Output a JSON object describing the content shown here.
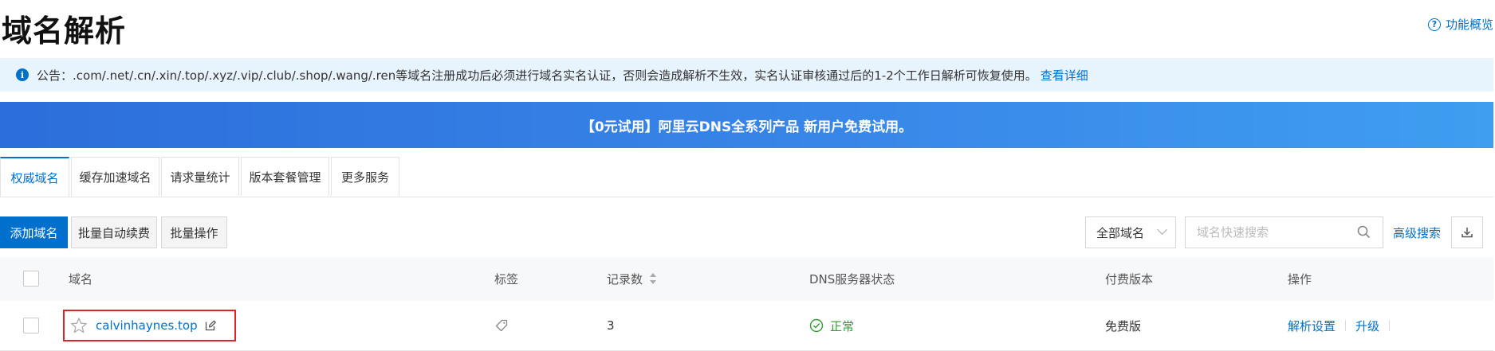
{
  "page": {
    "title": "域名解析",
    "overview_link": "功能概览"
  },
  "notice": {
    "text": "公告：.com/.net/.cn/.xin/.top/.xyz/.vip/.club/.shop/.wang/.ren等域名注册成功后必须进行域名实名认证，否则会造成解析不生效，实名认证审核通过后的1-2个工作日解析可恢复使用。",
    "link": "查看详细"
  },
  "banner": {
    "text": "【0元试用】阿里云DNS全系列产品 新用户免费试用。"
  },
  "tabs": [
    {
      "label": "权威域名",
      "active": true
    },
    {
      "label": "缓存加速域名",
      "active": false
    },
    {
      "label": "请求量统计",
      "active": false
    },
    {
      "label": "版本套餐管理",
      "active": false
    },
    {
      "label": "更多服务",
      "active": false
    }
  ],
  "toolbar": {
    "add_domain": "添加域名",
    "batch_renew": "批量自动续费",
    "batch_ops": "批量操作",
    "filter_selected": "全部域名",
    "search_placeholder": "域名快速搜索",
    "advanced_search": "高级搜索"
  },
  "table": {
    "columns": [
      "域名",
      "标签",
      "记录数",
      "DNS服务器状态",
      "付费版本",
      "操作"
    ],
    "rows": [
      {
        "domain": "calvinhaynes.top",
        "records": "3",
        "dns_status": "正常",
        "plan": "免费版",
        "actions": [
          "解析设置",
          "升级"
        ]
      }
    ]
  },
  "colors": {
    "accent": "#0070cc",
    "success": "#2e9e2e",
    "highlight_border": "#e0212a",
    "notice_bg": "#e8f4fd"
  }
}
